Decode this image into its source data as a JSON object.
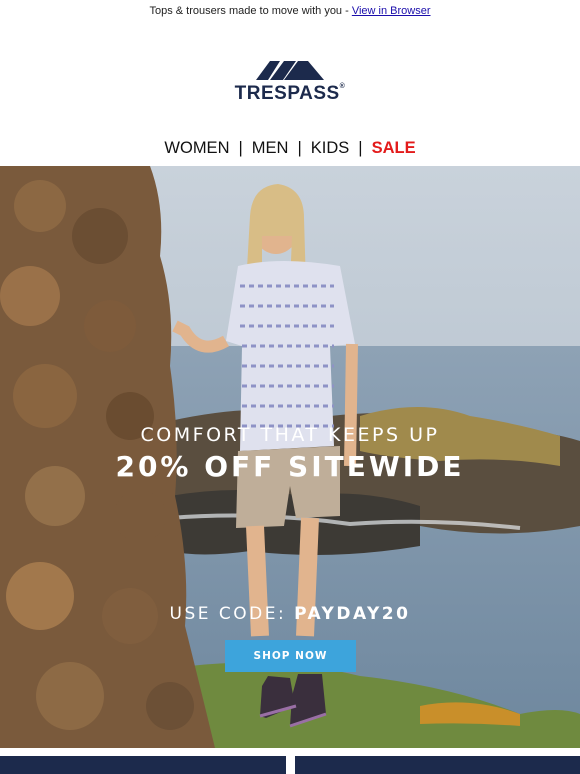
{
  "preheader": {
    "text": "Tops & trousers made to move with you - ",
    "link": "View in Browser"
  },
  "logo": {
    "brand": "TRESPASS",
    "mark": "®"
  },
  "nav": {
    "items": [
      "WOMEN",
      "MEN",
      "KIDS",
      "SALE"
    ],
    "separator": "|"
  },
  "hero": {
    "tagline": "COMFORT THAT KEEPS UP",
    "headline": "20% OFF SITEWIDE",
    "code_prefix": "USE CODE: ",
    "code": "PAYDAY20",
    "button": "SHOP NOW"
  },
  "colors": {
    "brand_navy": "#1c2a4c",
    "sale_red": "#e31b1b",
    "button_blue": "#3da4dc",
    "link_blue": "#1a0dab"
  }
}
